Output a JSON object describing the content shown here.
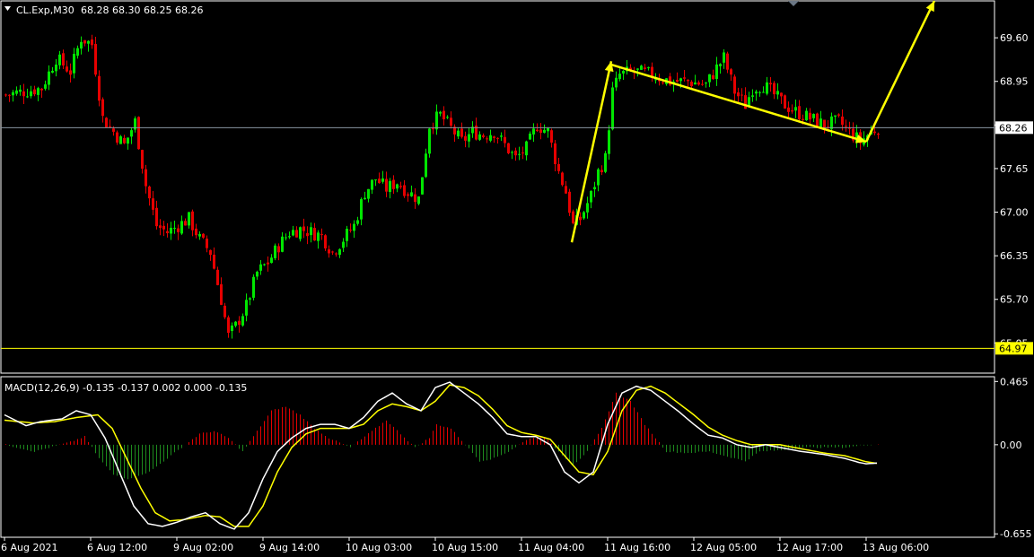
{
  "header": {
    "symbol": "CL.Exp,M30",
    "ohlc": "68.28 68.30 68.25 68.26"
  },
  "macd_header": {
    "label": "MACD(12,26,9)",
    "values": "-0.135 -0.137 0.002 0.000 -0.135"
  },
  "colors": {
    "background": "#000000",
    "bull": "#00e600",
    "bear": "#e60000",
    "macd_line": "#ffffff",
    "signal_line": "#ffff00",
    "annotation": "#ffff00",
    "support_line": "#ffff00",
    "grid_frame": "#ffffff"
  },
  "chart_data": [
    {
      "type": "candlestick",
      "name": "CL.Exp,M30",
      "ylim": [
        64.6,
        70.15
      ],
      "ticks": [
        "69.60",
        "68.95",
        "68.30",
        "67.65",
        "67.00",
        "66.35",
        "65.70",
        "65.05"
      ],
      "tick_values": [
        69.6,
        68.95,
        68.3,
        67.65,
        67.0,
        66.35,
        65.7,
        65.05
      ],
      "current_price": 68.26,
      "current_price_label": "68.26",
      "support_level": 64.97,
      "support_label": "64.97",
      "x_labels": [
        "6 Aug 2021",
        "6 Aug 12:00",
        "9 Aug 02:00",
        "9 Aug 14:00",
        "10 Aug 03:00",
        "10 Aug 15:00",
        "11 Aug 04:00",
        "11 Aug 16:00",
        "12 Aug 05:00",
        "12 Aug 17:00",
        "13 Aug 06:00"
      ],
      "x_label_bars": [
        0,
        24,
        48,
        72,
        96,
        120,
        144,
        168,
        192,
        216,
        240
      ],
      "bar_count": 244,
      "close_path": [
        [
          0,
          68.75
        ],
        [
          5,
          68.8
        ],
        [
          10,
          68.85
        ],
        [
          14,
          69.3
        ],
        [
          18,
          69.1
        ],
        [
          21,
          69.6
        ],
        [
          24,
          69.5
        ],
        [
          27,
          68.4
        ],
        [
          30,
          68.2
        ],
        [
          33,
          68.0
        ],
        [
          36,
          68.35
        ],
        [
          39,
          67.4
        ],
        [
          42,
          66.8
        ],
        [
          45,
          66.7
        ],
        [
          48,
          66.8
        ],
        [
          51,
          66.9
        ],
        [
          54,
          66.6
        ],
        [
          57,
          66.4
        ],
        [
          60,
          65.7
        ],
        [
          62,
          65.15
        ],
        [
          64,
          65.3
        ],
        [
          67,
          65.6
        ],
        [
          70,
          66.1
        ],
        [
          73,
          66.25
        ],
        [
          76,
          66.5
        ],
        [
          79,
          66.7
        ],
        [
          82,
          66.75
        ],
        [
          85,
          66.7
        ],
        [
          88,
          66.65
        ],
        [
          91,
          66.4
        ],
        [
          94,
          66.6
        ],
        [
          97,
          66.8
        ],
        [
          100,
          67.3
        ],
        [
          103,
          67.5
        ],
        [
          106,
          67.35
        ],
        [
          109,
          67.45
        ],
        [
          112,
          67.3
        ],
        [
          115,
          67.2
        ],
        [
          118,
          68.3
        ],
        [
          121,
          68.45
        ],
        [
          124,
          68.25
        ],
        [
          127,
          68.05
        ],
        [
          130,
          68.2
        ],
        [
          133,
          68.15
        ],
        [
          136,
          68.2
        ],
        [
          139,
          68.0
        ],
        [
          142,
          67.8
        ],
        [
          145,
          67.95
        ],
        [
          148,
          68.3
        ],
        [
          151,
          68.2
        ],
        [
          154,
          67.6
        ],
        [
          156,
          67.3
        ],
        [
          158,
          66.8
        ],
        [
          160,
          66.9
        ],
        [
          163,
          67.25
        ],
        [
          165,
          67.6
        ],
        [
          167,
          67.8
        ],
        [
          169,
          68.8
        ],
        [
          171,
          69.05
        ],
        [
          175,
          69.1
        ],
        [
          180,
          69.05
        ],
        [
          185,
          68.95
        ],
        [
          190,
          68.95
        ],
        [
          195,
          68.9
        ],
        [
          198,
          69.15
        ],
        [
          200,
          69.3
        ],
        [
          203,
          68.8
        ],
        [
          206,
          68.6
        ],
        [
          208,
          68.85
        ],
        [
          211,
          68.9
        ],
        [
          214,
          68.75
        ],
        [
          217,
          68.6
        ],
        [
          220,
          68.5
        ],
        [
          224,
          68.4
        ],
        [
          228,
          68.3
        ],
        [
          232,
          68.35
        ],
        [
          235,
          68.2
        ],
        [
          238,
          68.05
        ],
        [
          241,
          68.2
        ],
        [
          243,
          68.26
        ]
      ]
    },
    {
      "type": "line",
      "name": "MACD(12,26,9)",
      "ylim": [
        -0.68,
        0.5
      ],
      "ticks": [
        "0.465",
        "0.00",
        "-0.655"
      ],
      "tick_values": [
        0.465,
        0.0,
        -0.655
      ],
      "series": [
        {
          "role": "histogram",
          "points": [
            [
              0,
              0.0
            ],
            [
              8,
              -0.05
            ],
            [
              18,
              0.02
            ],
            [
              22,
              0.06
            ],
            [
              26,
              -0.1
            ],
            [
              30,
              -0.22
            ],
            [
              34,
              -0.25
            ],
            [
              40,
              -0.2
            ],
            [
              46,
              -0.08
            ],
            [
              50,
              0.0
            ],
            [
              54,
              0.08
            ],
            [
              58,
              0.1
            ],
            [
              62,
              0.05
            ],
            [
              66,
              -0.05
            ],
            [
              70,
              0.1
            ],
            [
              74,
              0.25
            ],
            [
              78,
              0.28
            ],
            [
              82,
              0.22
            ],
            [
              86,
              0.12
            ],
            [
              90,
              0.05
            ],
            [
              96,
              -0.02
            ],
            [
              102,
              0.1
            ],
            [
              106,
              0.18
            ],
            [
              110,
              0.08
            ],
            [
              114,
              -0.02
            ],
            [
              118,
              0.05
            ],
            [
              120,
              0.15
            ],
            [
              124,
              0.12
            ],
            [
              128,
              0.0
            ],
            [
              132,
              -0.12
            ],
            [
              136,
              -0.1
            ],
            [
              140,
              -0.05
            ],
            [
              146,
              0.05
            ],
            [
              150,
              0.06
            ],
            [
              154,
              -0.05
            ],
            [
              158,
              -0.15
            ],
            [
              162,
              -0.05
            ],
            [
              166,
              0.12
            ],
            [
              170,
              0.38
            ],
            [
              174,
              0.32
            ],
            [
              178,
              0.15
            ],
            [
              184,
              -0.05
            ],
            [
              190,
              -0.06
            ],
            [
              196,
              -0.05
            ],
            [
              200,
              -0.08
            ],
            [
              206,
              -0.12
            ],
            [
              210,
              -0.05
            ],
            [
              216,
              -0.04
            ],
            [
              222,
              -0.02
            ],
            [
              228,
              -0.02
            ],
            [
              234,
              -0.02
            ],
            [
              240,
              0.0
            ],
            [
              243,
              0.002
            ]
          ]
        },
        {
          "name": "MACD",
          "role": "macd",
          "points": [
            [
              0,
              0.22
            ],
            [
              6,
              0.14
            ],
            [
              10,
              0.17
            ],
            [
              16,
              0.19
            ],
            [
              20,
              0.25
            ],
            [
              24,
              0.22
            ],
            [
              28,
              0.05
            ],
            [
              32,
              -0.2
            ],
            [
              36,
              -0.45
            ],
            [
              40,
              -0.58
            ],
            [
              44,
              -0.6
            ],
            [
              48,
              -0.57
            ],
            [
              52,
              -0.53
            ],
            [
              56,
              -0.5
            ],
            [
              60,
              -0.58
            ],
            [
              64,
              -0.62
            ],
            [
              68,
              -0.5
            ],
            [
              72,
              -0.25
            ],
            [
              76,
              -0.05
            ],
            [
              80,
              0.05
            ],
            [
              84,
              0.12
            ],
            [
              88,
              0.15
            ],
            [
              92,
              0.15
            ],
            [
              96,
              0.12
            ],
            [
              100,
              0.2
            ],
            [
              104,
              0.32
            ],
            [
              108,
              0.38
            ],
            [
              112,
              0.3
            ],
            [
              116,
              0.25
            ],
            [
              120,
              0.42
            ],
            [
              124,
              0.46
            ],
            [
              128,
              0.38
            ],
            [
              132,
              0.3
            ],
            [
              136,
              0.2
            ],
            [
              140,
              0.08
            ],
            [
              144,
              0.06
            ],
            [
              148,
              0.06
            ],
            [
              152,
              0.0
            ],
            [
              156,
              -0.2
            ],
            [
              160,
              -0.28
            ],
            [
              164,
              -0.2
            ],
            [
              168,
              0.15
            ],
            [
              172,
              0.38
            ],
            [
              176,
              0.43
            ],
            [
              180,
              0.4
            ],
            [
              184,
              0.32
            ],
            [
              188,
              0.24
            ],
            [
              192,
              0.15
            ],
            [
              196,
              0.07
            ],
            [
              200,
              0.05
            ],
            [
              204,
              0.0
            ],
            [
              208,
              -0.02
            ],
            [
              212,
              0.0
            ],
            [
              216,
              -0.02
            ],
            [
              222,
              -0.05
            ],
            [
              228,
              -0.07
            ],
            [
              234,
              -0.1
            ],
            [
              238,
              -0.13
            ],
            [
              240,
              -0.14
            ],
            [
              243,
              -0.135
            ]
          ]
        },
        {
          "name": "Signal",
          "role": "signal",
          "points": [
            [
              0,
              0.18
            ],
            [
              8,
              0.16
            ],
            [
              14,
              0.17
            ],
            [
              20,
              0.2
            ],
            [
              26,
              0.22
            ],
            [
              30,
              0.12
            ],
            [
              34,
              -0.1
            ],
            [
              38,
              -0.32
            ],
            [
              42,
              -0.5
            ],
            [
              46,
              -0.56
            ],
            [
              50,
              -0.55
            ],
            [
              56,
              -0.52
            ],
            [
              60,
              -0.53
            ],
            [
              64,
              -0.6
            ],
            [
              68,
              -0.6
            ],
            [
              72,
              -0.45
            ],
            [
              76,
              -0.2
            ],
            [
              80,
              -0.02
            ],
            [
              84,
              0.08
            ],
            [
              88,
              0.12
            ],
            [
              92,
              0.12
            ],
            [
              96,
              0.12
            ],
            [
              100,
              0.15
            ],
            [
              104,
              0.25
            ],
            [
              108,
              0.3
            ],
            [
              112,
              0.28
            ],
            [
              116,
              0.25
            ],
            [
              120,
              0.32
            ],
            [
              124,
              0.44
            ],
            [
              128,
              0.42
            ],
            [
              132,
              0.36
            ],
            [
              136,
              0.26
            ],
            [
              140,
              0.14
            ],
            [
              144,
              0.09
            ],
            [
              148,
              0.07
            ],
            [
              152,
              0.04
            ],
            [
              156,
              -0.08
            ],
            [
              160,
              -0.2
            ],
            [
              164,
              -0.22
            ],
            [
              168,
              -0.05
            ],
            [
              172,
              0.25
            ],
            [
              176,
              0.4
            ],
            [
              180,
              0.43
            ],
            [
              184,
              0.38
            ],
            [
              188,
              0.3
            ],
            [
              192,
              0.22
            ],
            [
              196,
              0.13
            ],
            [
              200,
              0.07
            ],
            [
              204,
              0.03
            ],
            [
              208,
              0.0
            ],
            [
              212,
              0.0
            ],
            [
              216,
              0.0
            ],
            [
              222,
              -0.03
            ],
            [
              228,
              -0.06
            ],
            [
              234,
              -0.08
            ],
            [
              238,
              -0.11
            ],
            [
              240,
              -0.125
            ],
            [
              243,
              -0.137
            ]
          ]
        }
      ]
    }
  ],
  "annotations": [
    {
      "kind": "arrow",
      "from": [
        158,
        66.55
      ],
      "to": [
        169,
        69.25
      ]
    },
    {
      "kind": "arrow",
      "from": [
        169,
        69.2
      ],
      "to": [
        240,
        68.05
      ]
    },
    {
      "kind": "arrow",
      "from": [
        240,
        68.05
      ],
      "to": [
        259,
        70.15
      ]
    }
  ]
}
